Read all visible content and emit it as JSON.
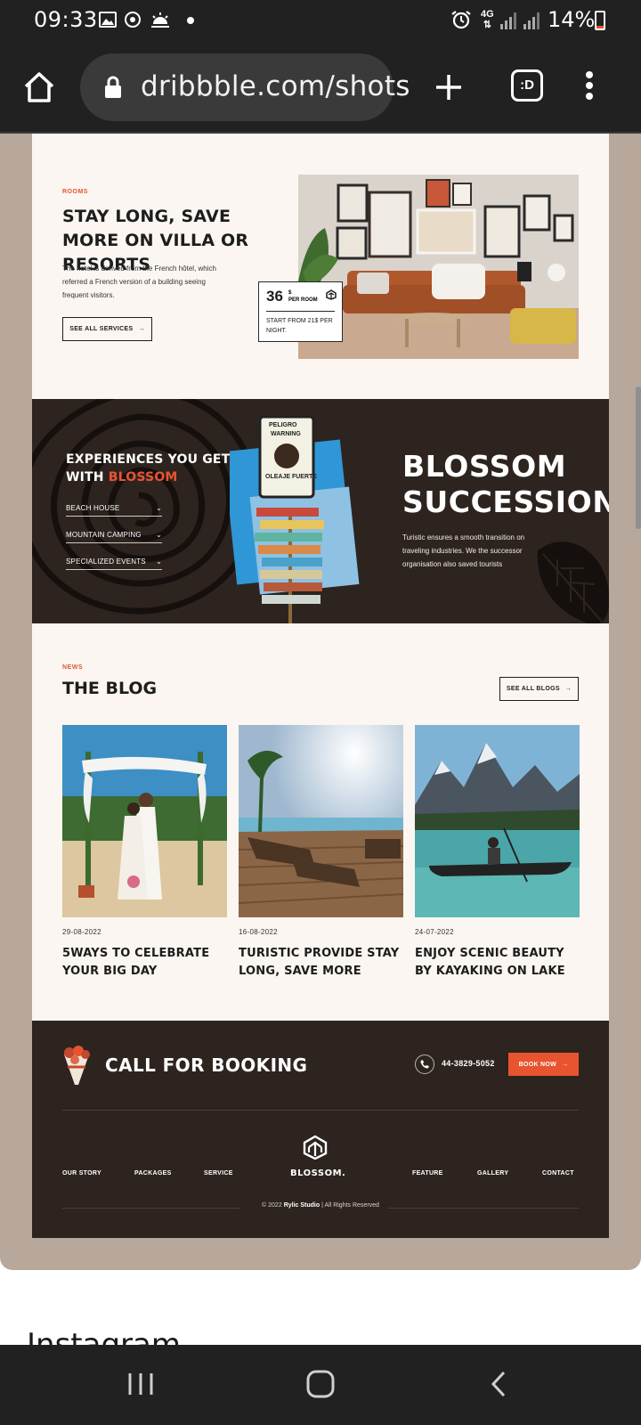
{
  "status": {
    "time": "09:33",
    "network": "4G",
    "battery": "14%"
  },
  "browser": {
    "url": "dribbble.com/shots",
    "tab_icon_label": ":D"
  },
  "rooms": {
    "tag": "ROOMS",
    "title": "STAY LONG, SAVE MORE ON VILLA OR RESORTS",
    "description": "The hotel is derived from the French hôtel, which referred a French version of a building seeing frequent visitors.",
    "button": "SEE ALL SERVICES",
    "price": "36",
    "price_unit_top": "$",
    "price_unit_bottom": "PER ROOM",
    "price_from": "START FROM 21$ PER NIGHT."
  },
  "experiences": {
    "title_line1": "EXPERIENCES YOU GET",
    "title_with": "WITH",
    "title_accent": "BLOSSOM",
    "items": [
      "BEACH HOUSE",
      "MOUNTAIN CAMPING",
      "SPECIALIZED EVENTS"
    ],
    "heading_line1": "BLOSSOM",
    "heading_line2": "SUCCESSION",
    "paragraph": "Turistic ensures a smooth transition on traveling industries. We the successor organisation also saved tourists",
    "sign_text_top": "PELIGRO",
    "sign_text_mid": "WARNING",
    "sign_text_low": "OLEAJE FUERTE"
  },
  "blog": {
    "tag": "NEWS",
    "title": "THE BLOG",
    "button": "SEE ALL BLOGS",
    "posts": [
      {
        "date": "29-08-2022",
        "title": "5WAYS TO CELEBRATE YOUR BIG DAY"
      },
      {
        "date": "16-08-2022",
        "title": "TURISTIC PROVIDE STAY LONG, SAVE MORE"
      },
      {
        "date": "24-07-2022",
        "title": "ENJOY SCENIC BEAUTY BY KAYAKING ON LAKE"
      }
    ]
  },
  "footer": {
    "call": "CALL FOR BOOKING",
    "phone": "44-3829-5052",
    "book": "BOOK NOW",
    "links_left": [
      "OUR STORY",
      "PACKAGES",
      "SERVICE"
    ],
    "links_right": [
      "FEATURE",
      "GALLERY",
      "CONTACT"
    ],
    "brand": "BLOSSOM.",
    "copy_prefix": "© 2022",
    "copy_studio": "Rylic Studio",
    "copy_suffix": "| All Rights Reserved"
  },
  "below": {
    "partial_heading": "Instagram"
  },
  "colors": {
    "accent": "#e8542f",
    "dark": "#2d2420",
    "cream": "#fbf6f1",
    "frame": "#b8a89c"
  }
}
